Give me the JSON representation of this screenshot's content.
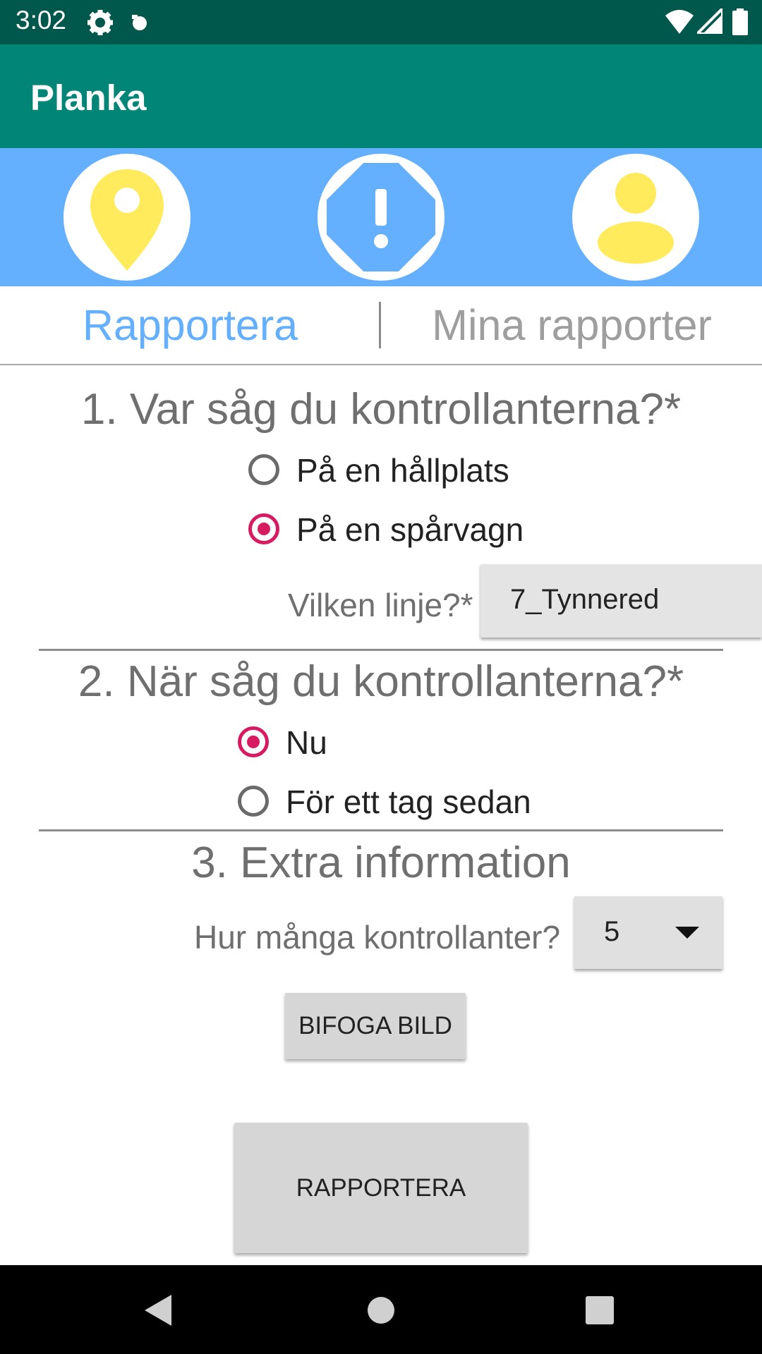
{
  "status_bar": {
    "time": "3:02"
  },
  "app_bar": {
    "title": "Planka"
  },
  "icon_band": {
    "icons": [
      "location-pin-icon",
      "alert-octagon-icon",
      "profile-icon"
    ],
    "colors": {
      "band": "#64B0FF",
      "icon": "#FFEB5B",
      "alert": "#64B0FF"
    }
  },
  "tabs": {
    "report": "Rapportera",
    "my_reports": "Mina rapporter",
    "active": "Rapportera"
  },
  "section1": {
    "title": "1. Var såg du kontrollanterna?*",
    "options": [
      {
        "label": "På en hållplats",
        "checked": false
      },
      {
        "label": "På en spårvagn",
        "checked": true
      }
    ],
    "line_label": "Vilken linje?*",
    "line_value": "7_Tynnered"
  },
  "section2": {
    "title": "2. När såg du kontrollanterna?*",
    "options": [
      {
        "label": "Nu",
        "checked": true
      },
      {
        "label": "För ett tag sedan",
        "checked": false
      }
    ]
  },
  "section3": {
    "title": "3. Extra information",
    "count_label": "Hur många kontrollanter?",
    "count_value": "5",
    "attach_button": "BIFOGA BILD"
  },
  "submit_button": "RAPPORTERA",
  "accent_colors": {
    "primary_dark": "#00574B",
    "primary": "#008577",
    "radio": "#D81B60"
  }
}
